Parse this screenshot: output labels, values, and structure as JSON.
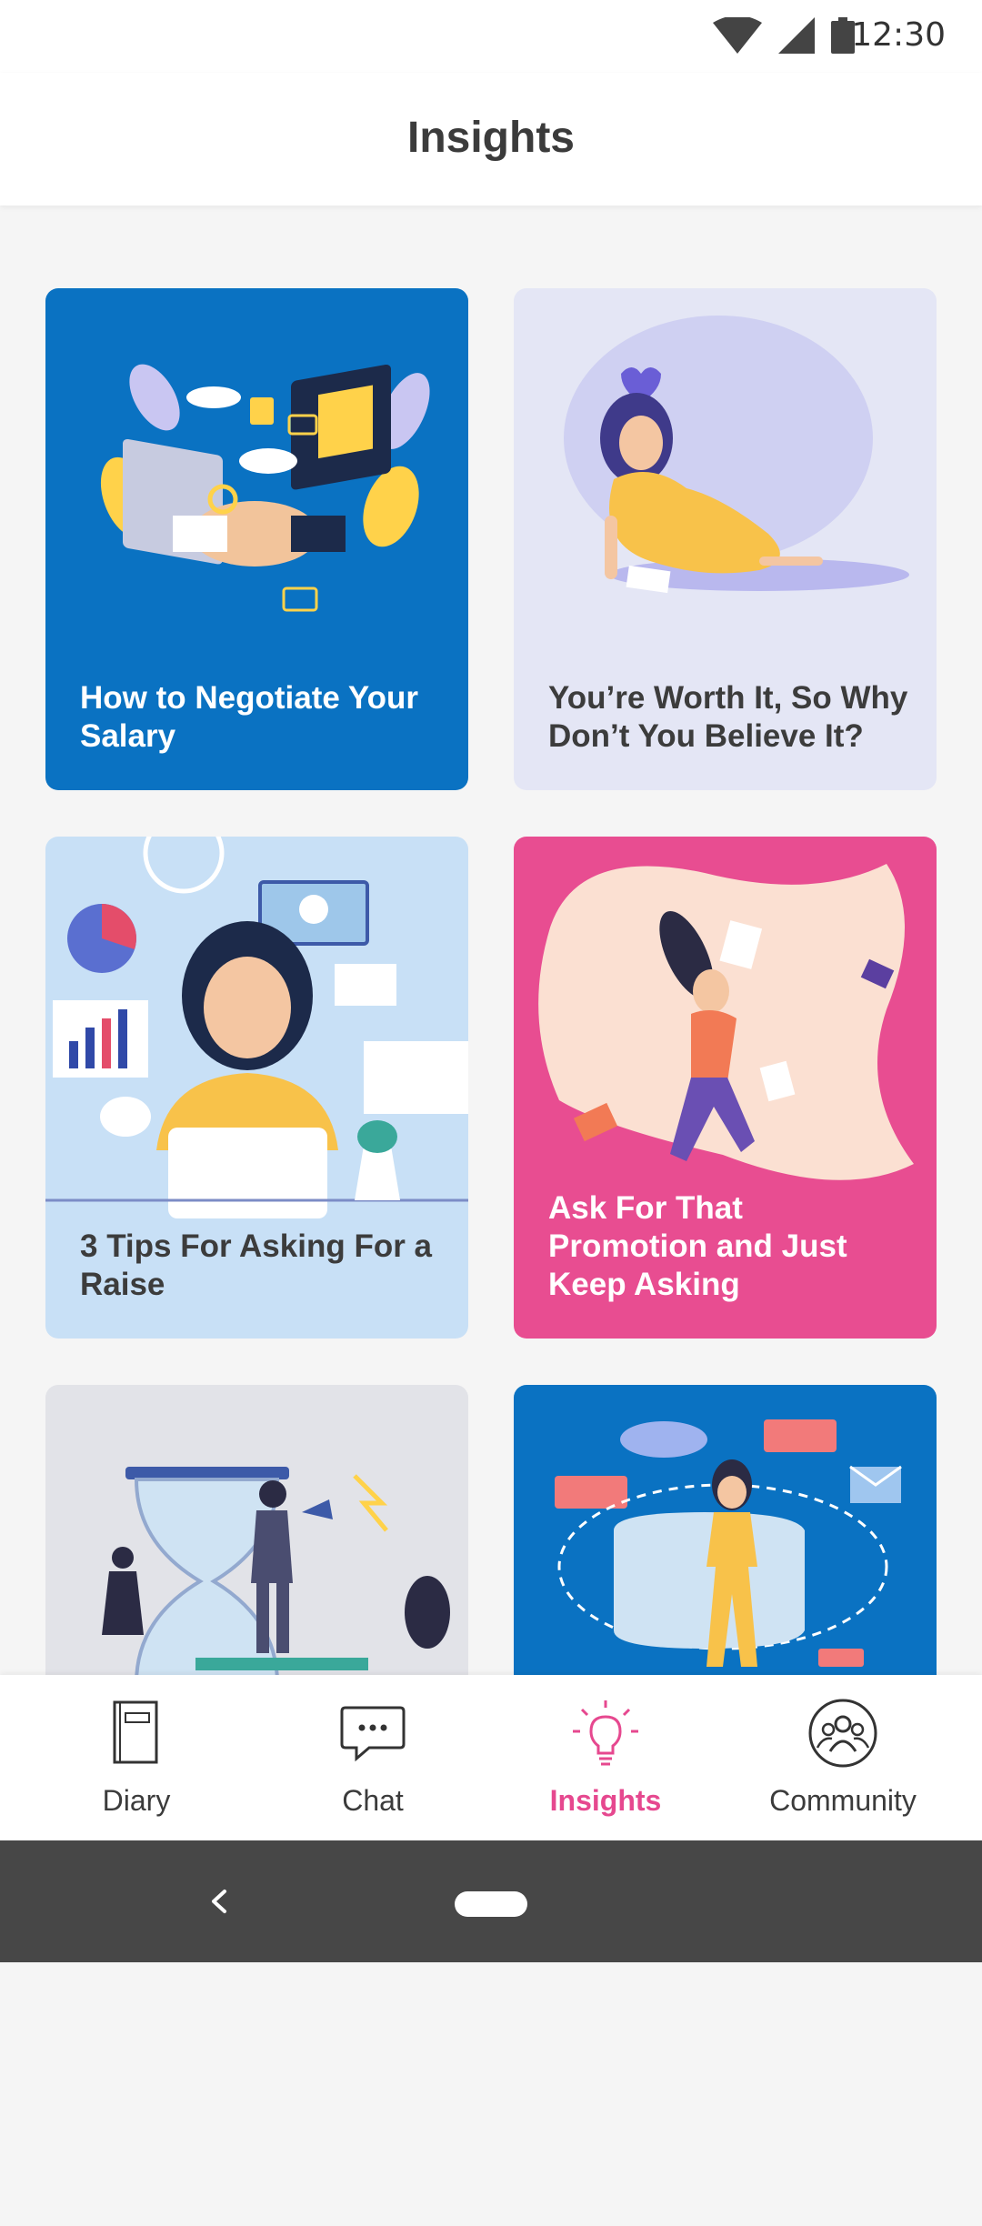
{
  "status_bar": {
    "time": "12:30",
    "icons": [
      "wifi-icon",
      "signal-icon",
      "battery-icon"
    ]
  },
  "header": {
    "title": "Insights"
  },
  "cards": [
    {
      "title": "How to Negotiate Your Salary",
      "bg": "#0a72c2"
    },
    {
      "title": "You’re Worth It, So Why Don’t You Believe It?",
      "bg": "#e4e6f5"
    },
    {
      "title": "3 Tips For Asking For a Raise",
      "bg": "#c8e0f6"
    },
    {
      "title": "Ask For That Promotion and Just Keep Asking",
      "bg": "#e84d91"
    },
    {
      "title": "",
      "bg": "#e2e3e8"
    },
    {
      "title": "",
      "bg": "#0a72c2"
    }
  ],
  "bottom_nav": {
    "active_color": "#e6488f",
    "items": [
      {
        "label": "Diary",
        "icon": "diary-icon"
      },
      {
        "label": "Chat",
        "icon": "chat-icon"
      },
      {
        "label": "Insights",
        "icon": "lightbulb-icon",
        "active": true
      },
      {
        "label": "Community",
        "icon": "community-icon"
      }
    ]
  }
}
